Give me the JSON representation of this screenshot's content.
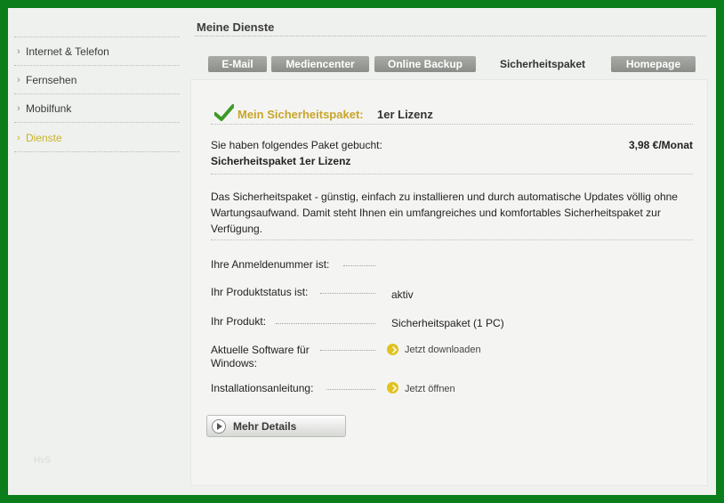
{
  "sidebar": {
    "items": [
      {
        "label": "Internet & Telefon"
      },
      {
        "label": "Fernsehen"
      },
      {
        "label": "Mobilfunk"
      },
      {
        "label": "Dienste",
        "active": true
      }
    ],
    "footer_text": "HvS"
  },
  "header": {
    "title": "Meine Dienste"
  },
  "tabs": [
    {
      "label": "E-Mail"
    },
    {
      "label": "Mediencenter"
    },
    {
      "label": "Online Backup"
    },
    {
      "label": "Sicherheitspaket",
      "active": true
    },
    {
      "label": "Homepage"
    }
  ],
  "panel": {
    "title_label": "Mein Sicherheitspaket:",
    "title_value": "1er Lizenz",
    "booked_text": "Sie haben folgendes Paket gebucht:",
    "package_name": "Sicherheitspaket 1er Lizenz",
    "price": "3,98 €/Monat",
    "description": "Das Sicherheitspaket - günstig, einfach zu installieren und durch automatische Updates völlig ohne Wartungsaufwand. Damit steht Ihnen ein umfangreiches und komfortables Sicherheitspaket zur Verfügung.",
    "fields": [
      {
        "label": "Ihre Anmeldenummer ist:",
        "value": ""
      },
      {
        "label": "Ihr Produktstatus ist:",
        "value": "aktiv"
      },
      {
        "label": "Ihr Produkt:",
        "value": "Sicherheitspaket (1 PC)"
      },
      {
        "label_line1": "Aktuelle Software für",
        "label_line2": "Windows:",
        "link": "Jetzt downloaden"
      },
      {
        "label": "Installationsanleitung:",
        "link": "Jetzt öffnen"
      }
    ],
    "more_button": "Mehr Details"
  },
  "colors": {
    "frame_border": "#0b7d1a",
    "accent": "#c8a52a",
    "active_nav": "#c8b32a",
    "link_circle": "#e1c21f",
    "check": "#3e9a25"
  },
  "icons": [
    "check-icon",
    "chevron-right-icon",
    "arrow-circle-icon",
    "play-circle-icon"
  ]
}
